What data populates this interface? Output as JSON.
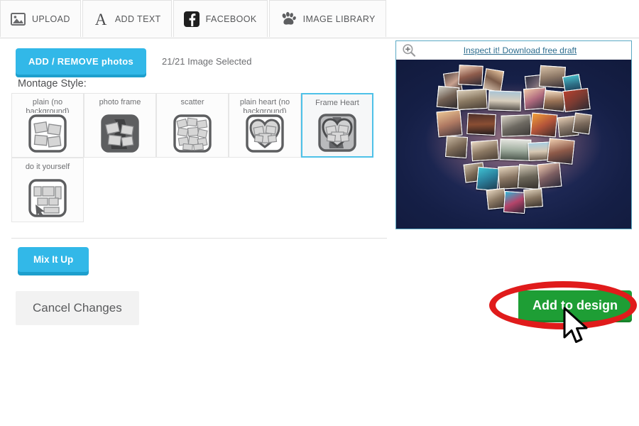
{
  "tabs": [
    {
      "label": "UPLOAD",
      "icon": "image-icon"
    },
    {
      "label": "ADD TEXT",
      "icon": "letter-a-icon"
    },
    {
      "label": "FACEBOOK",
      "icon": "facebook-icon"
    },
    {
      "label": "IMAGE LIBRARY",
      "icon": "paw-print-icon"
    }
  ],
  "left_panel": {
    "add_remove_label": "ADD / REMOVE photos",
    "selected_count_text": "21/21 Image Selected",
    "montage_style_label": "Montage Style:",
    "styles": [
      {
        "name": "plain (no background)",
        "thumb": "plain-thumb",
        "selected": false
      },
      {
        "name": "photo frame",
        "thumb": "photo-frame-thumb",
        "selected": false
      },
      {
        "name": "scatter",
        "thumb": "scatter-thumb",
        "selected": false
      },
      {
        "name": "plain heart (no background)",
        "thumb": "plain-heart-thumb",
        "selected": false
      },
      {
        "name": "Frame Heart",
        "thumb": "frame-heart-thumb",
        "selected": true
      },
      {
        "name": "do it yourself",
        "thumb": "do-it-yourself-thumb",
        "selected": false
      }
    ],
    "mix_it_up_label": "Mix It Up",
    "cancel_label": "Cancel Changes"
  },
  "preview": {
    "inspect_link": "Inspect it! Download free draft",
    "zoom_icon": "magnifier-plus-icon"
  },
  "actions": {
    "add_to_design_label": "Add to design"
  },
  "colors": {
    "accent_blue": "#32b8e8",
    "accent_blue_shadow": "#1d9fcd",
    "green": "#1e9e35",
    "annotation_red": "#e01b1b",
    "selected_border": "#4ec1e8",
    "link_blue": "#2d6d8e"
  }
}
